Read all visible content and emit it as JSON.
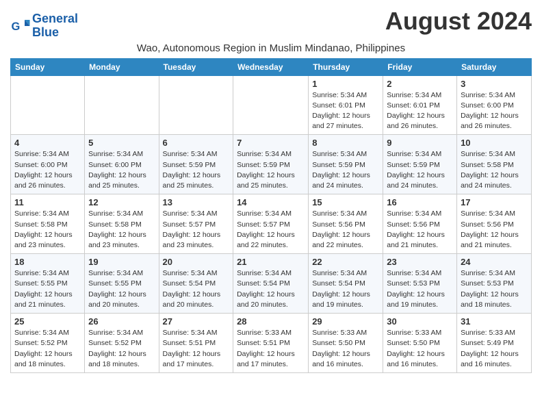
{
  "header": {
    "logo_line1": "General",
    "logo_line2": "Blue",
    "month_year": "August 2024",
    "subtitle": "Wao, Autonomous Region in Muslim Mindanao, Philippines"
  },
  "weekdays": [
    "Sunday",
    "Monday",
    "Tuesday",
    "Wednesday",
    "Thursday",
    "Friday",
    "Saturday"
  ],
  "weeks": [
    [
      {
        "day": "",
        "info": ""
      },
      {
        "day": "",
        "info": ""
      },
      {
        "day": "",
        "info": ""
      },
      {
        "day": "",
        "info": ""
      },
      {
        "day": "1",
        "info": "Sunrise: 5:34 AM\nSunset: 6:01 PM\nDaylight: 12 hours and 27 minutes."
      },
      {
        "day": "2",
        "info": "Sunrise: 5:34 AM\nSunset: 6:01 PM\nDaylight: 12 hours and 26 minutes."
      },
      {
        "day": "3",
        "info": "Sunrise: 5:34 AM\nSunset: 6:00 PM\nDaylight: 12 hours and 26 minutes."
      }
    ],
    [
      {
        "day": "4",
        "info": "Sunrise: 5:34 AM\nSunset: 6:00 PM\nDaylight: 12 hours and 26 minutes."
      },
      {
        "day": "5",
        "info": "Sunrise: 5:34 AM\nSunset: 6:00 PM\nDaylight: 12 hours and 25 minutes."
      },
      {
        "day": "6",
        "info": "Sunrise: 5:34 AM\nSunset: 5:59 PM\nDaylight: 12 hours and 25 minutes."
      },
      {
        "day": "7",
        "info": "Sunrise: 5:34 AM\nSunset: 5:59 PM\nDaylight: 12 hours and 25 minutes."
      },
      {
        "day": "8",
        "info": "Sunrise: 5:34 AM\nSunset: 5:59 PM\nDaylight: 12 hours and 24 minutes."
      },
      {
        "day": "9",
        "info": "Sunrise: 5:34 AM\nSunset: 5:59 PM\nDaylight: 12 hours and 24 minutes."
      },
      {
        "day": "10",
        "info": "Sunrise: 5:34 AM\nSunset: 5:58 PM\nDaylight: 12 hours and 24 minutes."
      }
    ],
    [
      {
        "day": "11",
        "info": "Sunrise: 5:34 AM\nSunset: 5:58 PM\nDaylight: 12 hours and 23 minutes."
      },
      {
        "day": "12",
        "info": "Sunrise: 5:34 AM\nSunset: 5:58 PM\nDaylight: 12 hours and 23 minutes."
      },
      {
        "day": "13",
        "info": "Sunrise: 5:34 AM\nSunset: 5:57 PM\nDaylight: 12 hours and 23 minutes."
      },
      {
        "day": "14",
        "info": "Sunrise: 5:34 AM\nSunset: 5:57 PM\nDaylight: 12 hours and 22 minutes."
      },
      {
        "day": "15",
        "info": "Sunrise: 5:34 AM\nSunset: 5:56 PM\nDaylight: 12 hours and 22 minutes."
      },
      {
        "day": "16",
        "info": "Sunrise: 5:34 AM\nSunset: 5:56 PM\nDaylight: 12 hours and 21 minutes."
      },
      {
        "day": "17",
        "info": "Sunrise: 5:34 AM\nSunset: 5:56 PM\nDaylight: 12 hours and 21 minutes."
      }
    ],
    [
      {
        "day": "18",
        "info": "Sunrise: 5:34 AM\nSunset: 5:55 PM\nDaylight: 12 hours and 21 minutes."
      },
      {
        "day": "19",
        "info": "Sunrise: 5:34 AM\nSunset: 5:55 PM\nDaylight: 12 hours and 20 minutes."
      },
      {
        "day": "20",
        "info": "Sunrise: 5:34 AM\nSunset: 5:54 PM\nDaylight: 12 hours and 20 minutes."
      },
      {
        "day": "21",
        "info": "Sunrise: 5:34 AM\nSunset: 5:54 PM\nDaylight: 12 hours and 20 minutes."
      },
      {
        "day": "22",
        "info": "Sunrise: 5:34 AM\nSunset: 5:54 PM\nDaylight: 12 hours and 19 minutes."
      },
      {
        "day": "23",
        "info": "Sunrise: 5:34 AM\nSunset: 5:53 PM\nDaylight: 12 hours and 19 minutes."
      },
      {
        "day": "24",
        "info": "Sunrise: 5:34 AM\nSunset: 5:53 PM\nDaylight: 12 hours and 18 minutes."
      }
    ],
    [
      {
        "day": "25",
        "info": "Sunrise: 5:34 AM\nSunset: 5:52 PM\nDaylight: 12 hours and 18 minutes."
      },
      {
        "day": "26",
        "info": "Sunrise: 5:34 AM\nSunset: 5:52 PM\nDaylight: 12 hours and 18 minutes."
      },
      {
        "day": "27",
        "info": "Sunrise: 5:34 AM\nSunset: 5:51 PM\nDaylight: 12 hours and 17 minutes."
      },
      {
        "day": "28",
        "info": "Sunrise: 5:33 AM\nSunset: 5:51 PM\nDaylight: 12 hours and 17 minutes."
      },
      {
        "day": "29",
        "info": "Sunrise: 5:33 AM\nSunset: 5:50 PM\nDaylight: 12 hours and 16 minutes."
      },
      {
        "day": "30",
        "info": "Sunrise: 5:33 AM\nSunset: 5:50 PM\nDaylight: 12 hours and 16 minutes."
      },
      {
        "day": "31",
        "info": "Sunrise: 5:33 AM\nSunset: 5:49 PM\nDaylight: 12 hours and 16 minutes."
      }
    ]
  ]
}
